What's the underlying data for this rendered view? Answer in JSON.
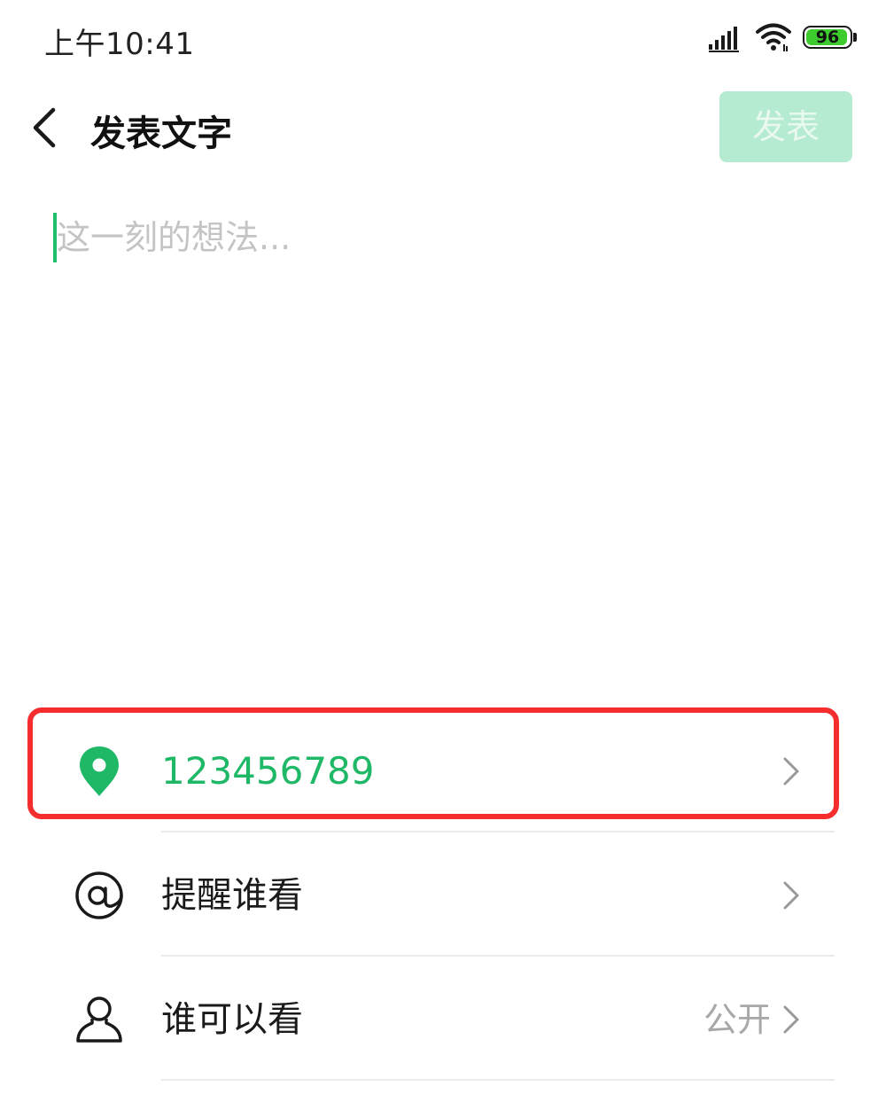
{
  "status_bar": {
    "time": "上午10:41",
    "battery_level": "96",
    "battery_fraction": 0.96,
    "icons": [
      "signal-icon",
      "wifi-icon",
      "battery-icon"
    ]
  },
  "header": {
    "back_icon": "chevron-left-icon",
    "title": "发表文字",
    "publish_label": "发表"
  },
  "composer": {
    "value": "",
    "placeholder": "这一刻的想法..."
  },
  "options": {
    "location": {
      "icon": "location-pin-icon",
      "label": "123456789",
      "color": "#1fb866"
    },
    "mention": {
      "icon": "at-icon",
      "label": "提醒谁看"
    },
    "visibility": {
      "icon": "person-icon",
      "label": "谁可以看",
      "value": "公开"
    }
  },
  "colors": {
    "accent": "#1fb866",
    "publish_disabled_bg": "#b5ebd0",
    "highlight_border": "#f52d2d",
    "battery_green": "#3dcb2e"
  }
}
